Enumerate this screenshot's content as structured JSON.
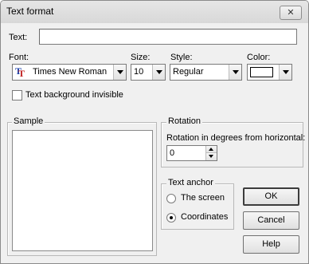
{
  "window": {
    "title": "Text format",
    "close_glyph": "✕"
  },
  "text_field": {
    "label": "Text:",
    "value": ""
  },
  "font": {
    "label": "Font:",
    "value": "Times New Roman",
    "icon": "truetype-font-icon"
  },
  "size": {
    "label": "Size:",
    "value": "10"
  },
  "style": {
    "label": "Style:",
    "value": "Regular"
  },
  "color": {
    "label": "Color:",
    "value": "#ffffff"
  },
  "background_invisible": {
    "label": "Text background invisible",
    "checked": false
  },
  "sample": {
    "title": "Sample"
  },
  "rotation": {
    "title": "Rotation",
    "label": "Rotation in degrees from horizontal:",
    "value": "0"
  },
  "text_anchor": {
    "title": "Text anchor",
    "options": [
      {
        "label": "The screen",
        "selected": false
      },
      {
        "label": "Coordinates",
        "selected": true
      }
    ]
  },
  "buttons": {
    "ok": "OK",
    "cancel": "Cancel",
    "help": "Help"
  }
}
